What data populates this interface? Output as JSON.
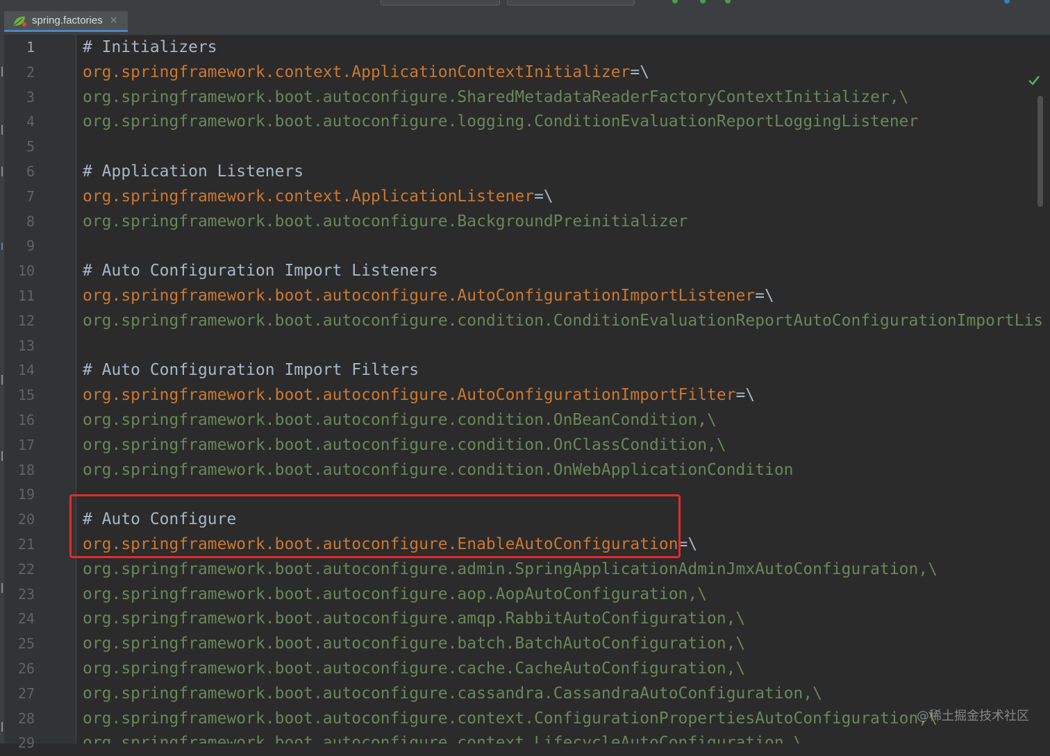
{
  "editor_tab": {
    "title": "spring.factories",
    "close_glyph": "✕",
    "icon": "spring-leaf-icon"
  },
  "colors": {
    "comment": "#a9b7c6",
    "property_key": "#cc7832",
    "property_value": "#6a8759",
    "highlight_border": "#e52b2b",
    "background": "#2b2b2b"
  },
  "status": {
    "inspection_icon": "check-icon"
  },
  "current_line": 1,
  "lines": [
    {
      "n": "1",
      "type": "comment",
      "text": "# Initializers"
    },
    {
      "n": "2",
      "type": "key",
      "text": "org.springframework.context.ApplicationContextInitializer",
      "tail": "=\\"
    },
    {
      "n": "3",
      "type": "value",
      "text": "org.springframework.boot.autoconfigure.SharedMetadataReaderFactoryContextInitializer,\\"
    },
    {
      "n": "4",
      "type": "value",
      "text": "org.springframework.boot.autoconfigure.logging.ConditionEvaluationReportLoggingListener"
    },
    {
      "n": "5",
      "type": "blank",
      "text": ""
    },
    {
      "n": "6",
      "type": "comment",
      "text": "# Application Listeners"
    },
    {
      "n": "7",
      "type": "key",
      "text": "org.springframework.context.ApplicationListener",
      "tail": "=\\"
    },
    {
      "n": "8",
      "type": "value",
      "text": "org.springframework.boot.autoconfigure.BackgroundPreinitializer"
    },
    {
      "n": "9",
      "type": "blank",
      "text": ""
    },
    {
      "n": "10",
      "type": "comment",
      "text": "# Auto Configuration Import Listeners"
    },
    {
      "n": "11",
      "type": "key",
      "text": "org.springframework.boot.autoconfigure.AutoConfigurationImportListener",
      "tail": "=\\"
    },
    {
      "n": "12",
      "type": "value",
      "text": "org.springframework.boot.autoconfigure.condition.ConditionEvaluationReportAutoConfigurationImportListe"
    },
    {
      "n": "13",
      "type": "blank",
      "text": ""
    },
    {
      "n": "14",
      "type": "comment",
      "text": "# Auto Configuration Import Filters"
    },
    {
      "n": "15",
      "type": "key",
      "text": "org.springframework.boot.autoconfigure.AutoConfigurationImportFilter",
      "tail": "=\\"
    },
    {
      "n": "16",
      "type": "value",
      "text": "org.springframework.boot.autoconfigure.condition.OnBeanCondition,\\"
    },
    {
      "n": "17",
      "type": "value",
      "text": "org.springframework.boot.autoconfigure.condition.OnClassCondition,\\"
    },
    {
      "n": "18",
      "type": "value",
      "text": "org.springframework.boot.autoconfigure.condition.OnWebApplicationCondition"
    },
    {
      "n": "19",
      "type": "blank",
      "text": ""
    },
    {
      "n": "20",
      "type": "comment",
      "text": "# Auto Configure"
    },
    {
      "n": "21",
      "type": "key",
      "text": "org.springframework.boot.autoconfigure.EnableAutoConfiguration",
      "tail": "=\\"
    },
    {
      "n": "22",
      "type": "value",
      "text": "org.springframework.boot.autoconfigure.admin.SpringApplicationAdminJmxAutoConfiguration,\\"
    },
    {
      "n": "23",
      "type": "value",
      "text": "org.springframework.boot.autoconfigure.aop.AopAutoConfiguration,\\"
    },
    {
      "n": "24",
      "type": "value",
      "text": "org.springframework.boot.autoconfigure.amqp.RabbitAutoConfiguration,\\"
    },
    {
      "n": "25",
      "type": "value",
      "text": "org.springframework.boot.autoconfigure.batch.BatchAutoConfiguration,\\"
    },
    {
      "n": "26",
      "type": "value",
      "text": "org.springframework.boot.autoconfigure.cache.CacheAutoConfiguration,\\"
    },
    {
      "n": "27",
      "type": "value",
      "text": "org.springframework.boot.autoconfigure.cassandra.CassandraAutoConfiguration,\\"
    },
    {
      "n": "28",
      "type": "value",
      "text": "org.springframework.boot.autoconfigure.context.ConfigurationPropertiesAutoConfiguration,\\"
    },
    {
      "n": "29",
      "type": "value",
      "text": "org.springframework.boot.autoconfigure.context.LifecycleAutoConfiguration,\\"
    }
  ],
  "highlighted_lines": [
    "20",
    "21"
  ],
  "watermark": "@稀土掘金技术社区"
}
